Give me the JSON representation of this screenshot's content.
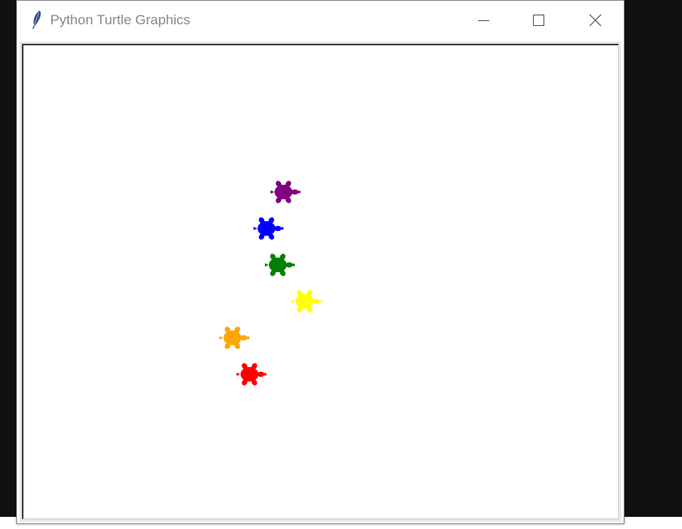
{
  "window": {
    "title": "Python Turtle Graphics",
    "icon": "feather-icon",
    "controls": [
      "minimize-icon",
      "maximize-icon",
      "close-icon"
    ]
  },
  "turtles": [
    {
      "name": "turtle-purple",
      "color": "#800080"
    },
    {
      "name": "turtle-blue",
      "color": "#0000ff"
    },
    {
      "name": "turtle-green",
      "color": "#008000"
    },
    {
      "name": "turtle-yellow",
      "color": "#ffff00"
    },
    {
      "name": "turtle-orange",
      "color": "#ffa500"
    },
    {
      "name": "turtle-red",
      "color": "#ff0000"
    }
  ]
}
